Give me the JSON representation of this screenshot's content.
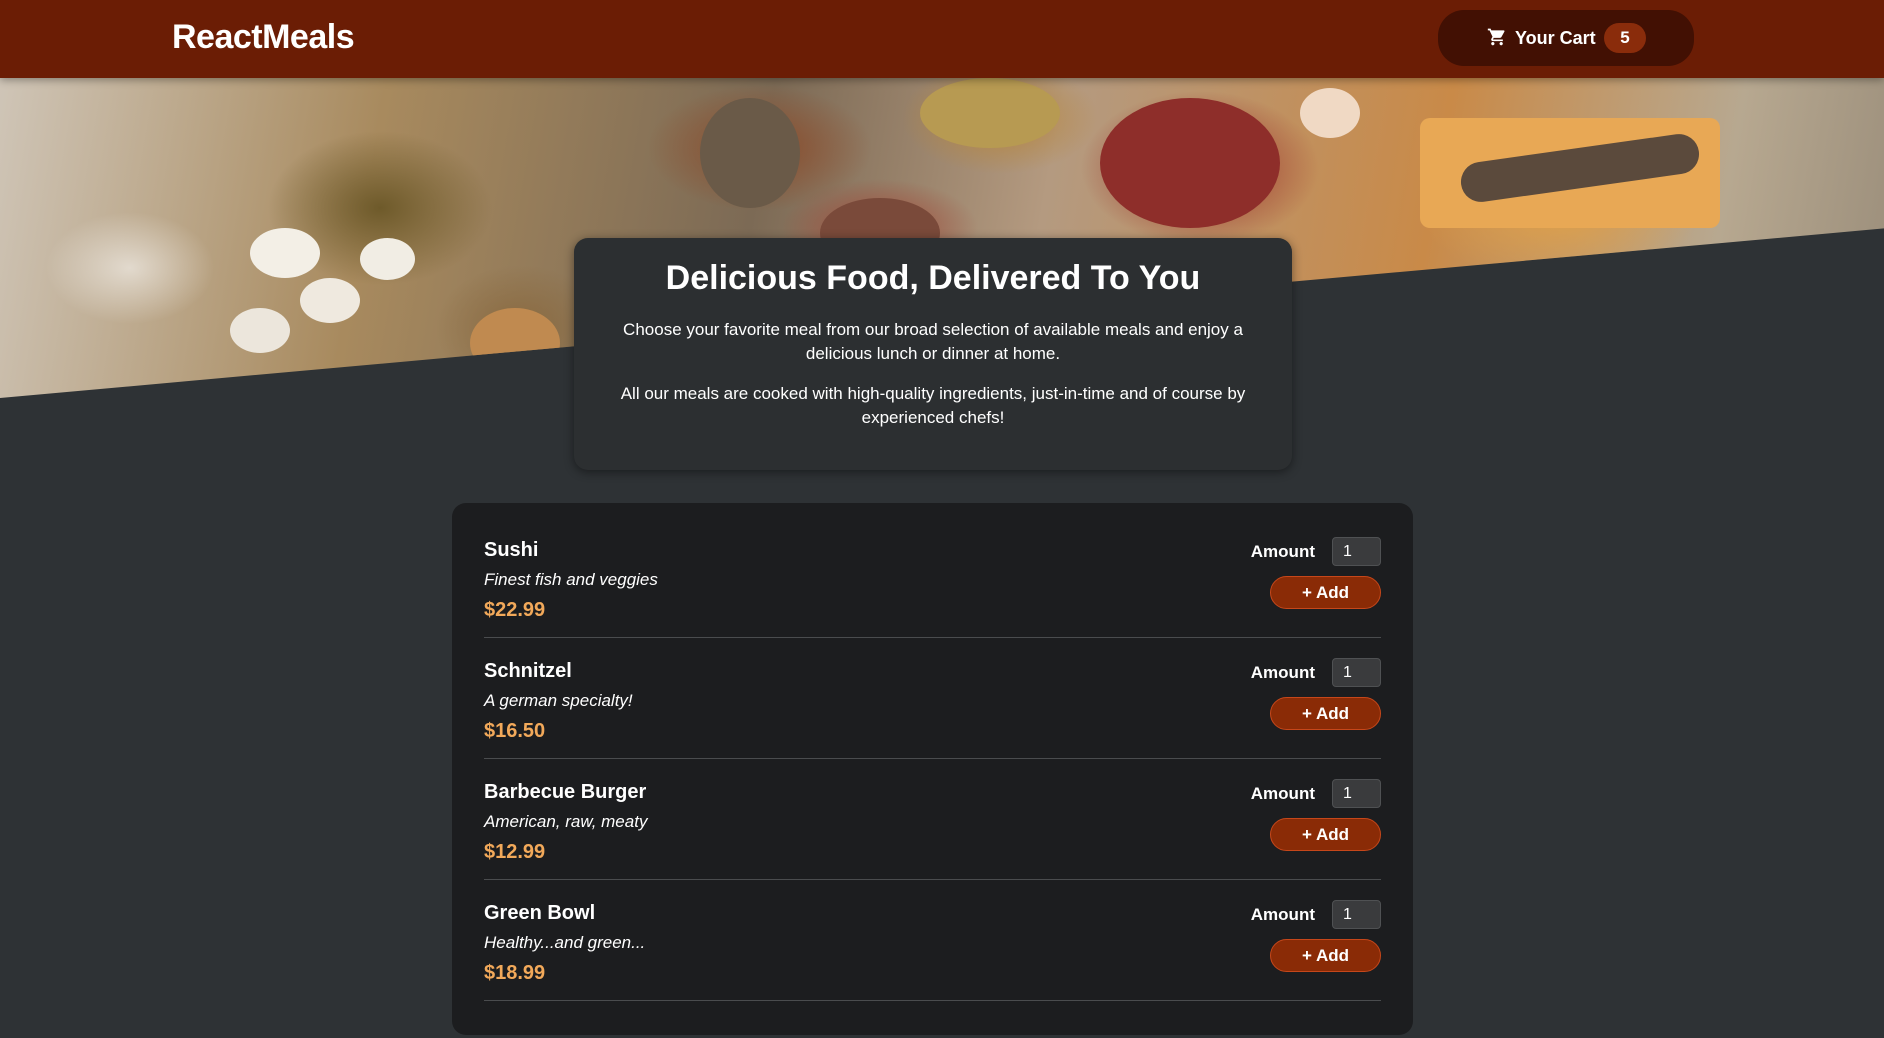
{
  "header": {
    "logo": "ReactMeals",
    "cart_label": "Your Cart",
    "cart_count": "5",
    "cart_icon": "shopping-cart-icon"
  },
  "summary": {
    "title": "Delicious Food, Delivered To You",
    "paragraph1": "Choose your favorite meal from our broad selection of available meals and enjoy a delicious lunch or dinner at home.",
    "paragraph2": "All our meals are cooked with high-quality ingredients, just-in-time and of course by experienced chefs!"
  },
  "meals": [
    {
      "name": "Sushi",
      "description": "Finest fish and veggies",
      "price": "$22.99",
      "amount_label": "Amount",
      "amount": "1",
      "add_label": "+ Add"
    },
    {
      "name": "Schnitzel",
      "description": "A german specialty!",
      "price": "$16.50",
      "amount_label": "Amount",
      "amount": "1",
      "add_label": "+ Add"
    },
    {
      "name": "Barbecue Burger",
      "description": "American, raw, meaty",
      "price": "$12.99",
      "amount_label": "Amount",
      "amount": "1",
      "add_label": "+ Add"
    },
    {
      "name": "Green Bowl",
      "description": "Healthy...and green...",
      "price": "$18.99",
      "amount_label": "Amount",
      "amount": "1",
      "add_label": "+ Add"
    }
  ],
  "colors": {
    "header_bg": "#6b1d05",
    "cart_bg": "#421003",
    "badge_bg": "#8a2c0b",
    "page_bg": "#2e3235",
    "card_bg": "#1c1d1f",
    "price": "#f2a95a",
    "add_button_bg": "#8a2b06"
  }
}
